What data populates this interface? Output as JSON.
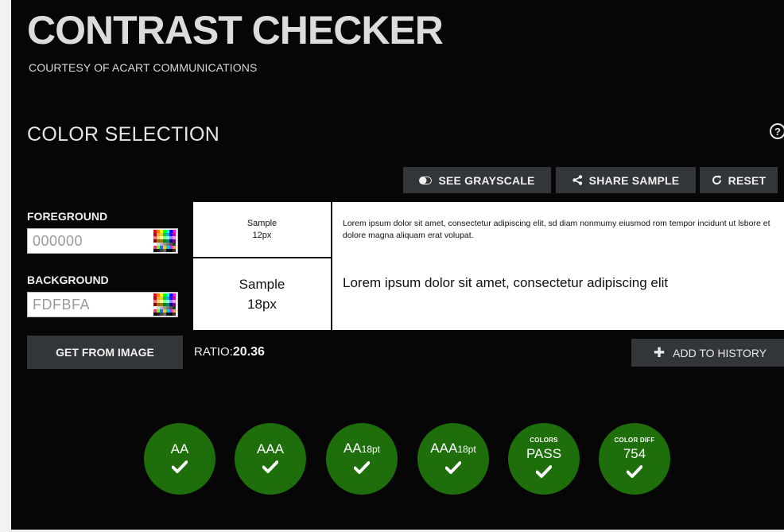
{
  "header": {
    "title": "CONTRAST CHECKER",
    "subtitle": "COURTESY OF ACART COMMUNICATIONS"
  },
  "section": {
    "title": "COLOR SELECTION",
    "help_icon": "help-circle-icon"
  },
  "toolbar": {
    "grayscale_label": "SEE GRAYSCALE",
    "share_label": "SHARE SAMPLE",
    "reset_label": "RESET"
  },
  "foreground": {
    "label": "FOREGROUND",
    "value": "000000",
    "color": "#000000"
  },
  "background": {
    "label": "BACKGROUND",
    "value": "FDFBFA",
    "color": "#FDFBFA"
  },
  "get_from_image_label": "GET FROM IMAGE",
  "samples": {
    "small_label_1": "Sample",
    "small_label_2": "12px",
    "large_label_1": "Sample",
    "large_label_2": "18px",
    "small_text": "Lorem ipsum dolor sit amet, consectetur adipiscing elit, sd diam nonmumy eiusmod rom tempor incidunt ut lsbore et dolore magna aliquam erat volupat.",
    "large_text": "Lorem ipsum dolor sit amet, consectetur adipiscing elit"
  },
  "ratio": {
    "label": "RATIO:",
    "value": "20.36"
  },
  "add_history_label": "ADD TO HISTORY",
  "results": [
    {
      "top": "",
      "main": "AA",
      "sub": ""
    },
    {
      "top": "",
      "main": "AAA",
      "sub": ""
    },
    {
      "top": "",
      "main": "AA",
      "sub": "18pt"
    },
    {
      "top": "",
      "main": "AAA",
      "sub": "18pt"
    },
    {
      "top": "COLORS",
      "main": "PASS",
      "sub": ""
    },
    {
      "top": "COLOR DIFF",
      "main": "754",
      "sub": ""
    }
  ],
  "colors": {
    "pass_green": "#1e6e0c",
    "button_bg": "#32353a",
    "page_bg": "#060606"
  }
}
